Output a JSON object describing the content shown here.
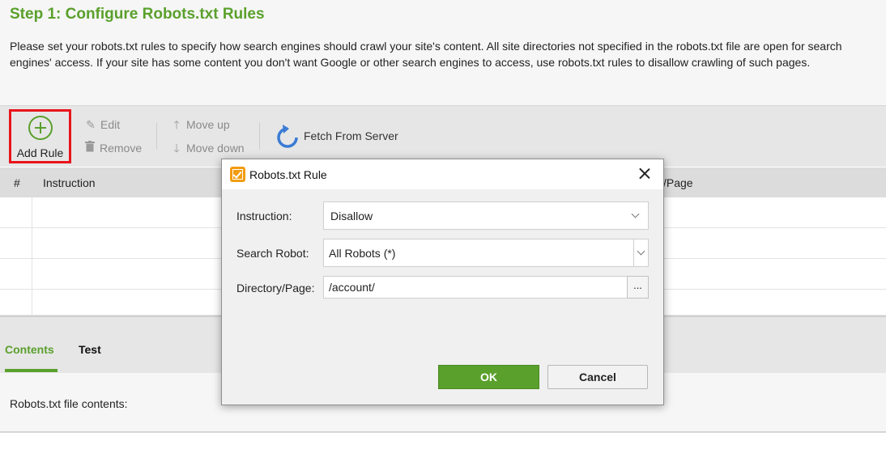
{
  "intro": {
    "title": "Step 1: Configure Robots.txt Rules",
    "description": "Please set your robots.txt rules to specify how search engines should crawl your site's content. All site directories not specified in the robots.txt file are open for search engines' access. If your site has some content you don't want Google or other search engines to access, use robots.txt rules to disallow crawling of such pages."
  },
  "toolbar": {
    "add_rule": "Add Rule",
    "edit": "Edit",
    "remove": "Remove",
    "move_up": "Move up",
    "move_down": "Move down",
    "fetch": "Fetch From Server",
    "icons": {
      "add": "plus-circle-icon",
      "edit": "pencil-icon",
      "remove": "trash-icon",
      "move_up": "arrow-up-icon",
      "move_down": "arrow-down-icon",
      "fetch": "refresh-icon"
    }
  },
  "table": {
    "columns": [
      "#",
      "Instruction",
      "/Page"
    ]
  },
  "tabs": {
    "contents": "Contents",
    "test": "Test",
    "active": "Contents"
  },
  "contents": {
    "label": "Robots.txt file contents:"
  },
  "dialog": {
    "title": "Robots.txt Rule",
    "instruction_label": "Instruction:",
    "instruction_value": "Disallow",
    "robot_label": "Search Robot:",
    "robot_value": "All Robots (*)",
    "directory_label": "Directory/Page:",
    "directory_value": "/account/",
    "browse_label": "...",
    "ok": "OK",
    "cancel": "Cancel"
  },
  "colors": {
    "accent": "#5aa02c",
    "highlight": "#e8141b",
    "fetch_icon": "#3a7bd5",
    "dialog_icon": "#f39c12"
  }
}
